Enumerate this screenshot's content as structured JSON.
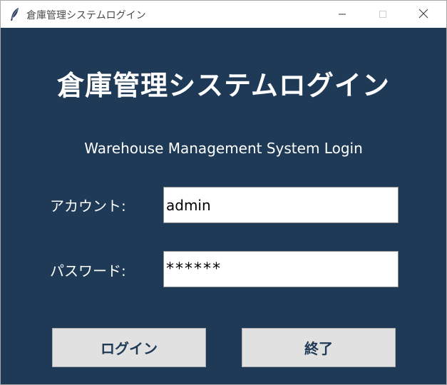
{
  "window": {
    "title": "倉庫管理システムログイン",
    "icons": {
      "app": "feather-icon",
      "minimize": "minimize-icon",
      "maximize": "maximize-icon",
      "close": "close-icon"
    }
  },
  "main": {
    "heading": "倉庫管理システムログイン",
    "subtitle": "Warehouse Management System Login"
  },
  "form": {
    "account_label": "アカウント:",
    "account_value": "admin",
    "password_label": "パスワード:",
    "password_value": "******"
  },
  "buttons": {
    "login": "ログイン",
    "exit": "終了"
  },
  "colors": {
    "background": "#1e3a56",
    "button_bg": "#e1e1e1",
    "button_text": "#1e3a56",
    "text": "#ffffff"
  }
}
